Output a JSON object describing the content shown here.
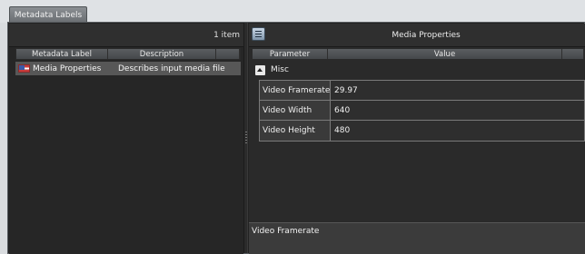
{
  "tab": {
    "label": "Metadata Labels"
  },
  "left": {
    "item_count": "1 item",
    "columns": [
      "Metadata Label",
      "Description"
    ],
    "rows": [
      {
        "label": "Media Properties",
        "description": "Describes input media file"
      }
    ]
  },
  "right": {
    "title": "Media Properties",
    "columns": [
      "Parameter",
      "Value"
    ],
    "group": "Misc",
    "properties": [
      {
        "key": "Video Framerate",
        "value": "29.97"
      },
      {
        "key": "Video Width",
        "value": "640"
      },
      {
        "key": "Video Height",
        "value": "480"
      }
    ],
    "description_panel": "Video Framerate"
  }
}
